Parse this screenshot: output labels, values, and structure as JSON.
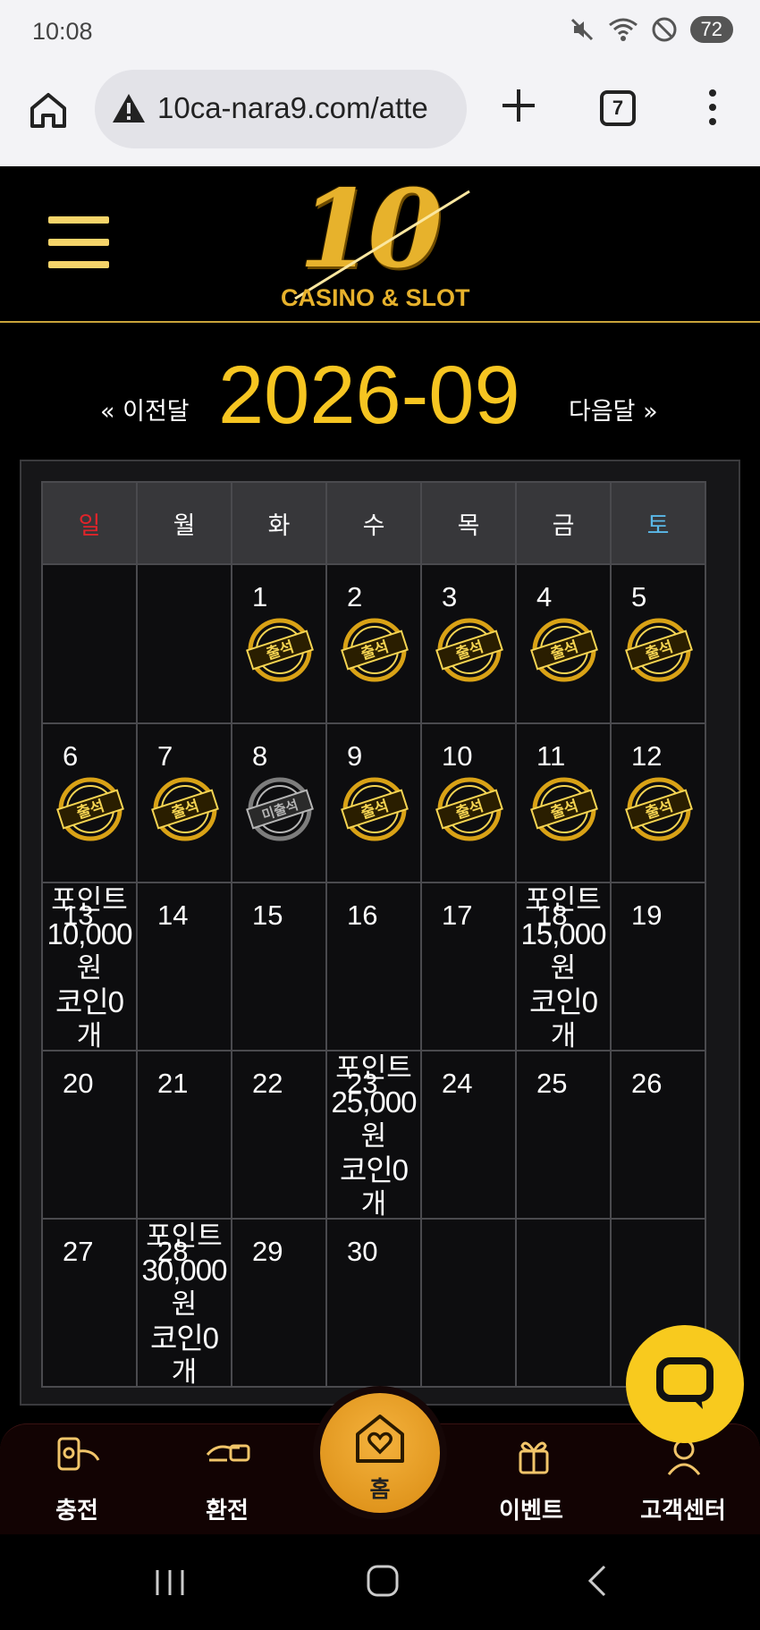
{
  "status_bar": {
    "time": "10:08",
    "battery": "72"
  },
  "browser": {
    "url": "10ca-nara9.com/atte",
    "tab_count": "7"
  },
  "logo": {
    "number": "10",
    "subtitle": "CASINO & SLOT"
  },
  "calendar": {
    "prev_label": "« 이전달",
    "month": "2026-09",
    "next_label": "다음달 »",
    "weekdays": [
      "일",
      "월",
      "화",
      "수",
      "목",
      "금",
      "토"
    ],
    "stamp_attended": "출석",
    "stamp_absent": "미출석",
    "weeks": [
      [
        {
          "day": "",
          "stamp": ""
        },
        {
          "day": "",
          "stamp": ""
        },
        {
          "day": "1",
          "stamp": "attended"
        },
        {
          "day": "2",
          "stamp": "attended"
        },
        {
          "day": "3",
          "stamp": "attended"
        },
        {
          "day": "4",
          "stamp": "attended"
        },
        {
          "day": "5",
          "stamp": "attended"
        }
      ],
      [
        {
          "day": "6",
          "stamp": "attended"
        },
        {
          "day": "7",
          "stamp": "attended"
        },
        {
          "day": "8",
          "stamp": "absent"
        },
        {
          "day": "9",
          "stamp": "attended"
        },
        {
          "day": "10",
          "stamp": "attended"
        },
        {
          "day": "11",
          "stamp": "attended"
        },
        {
          "day": "12",
          "stamp": "attended"
        }
      ],
      [
        {
          "day": "13",
          "reward": {
            "line1": "포인트",
            "amount": "10,000",
            "unit": "원",
            "coin": "코인0",
            "coin_unit": "개"
          }
        },
        {
          "day": "14"
        },
        {
          "day": "15"
        },
        {
          "day": "16"
        },
        {
          "day": "17"
        },
        {
          "day": "18",
          "reward": {
            "line1": "포인트",
            "amount": "15,000",
            "unit": "원",
            "coin": "코인0",
            "coin_unit": "개"
          }
        },
        {
          "day": "19"
        }
      ],
      [
        {
          "day": "20"
        },
        {
          "day": "21"
        },
        {
          "day": "22"
        },
        {
          "day": "23",
          "reward": {
            "line1": "포인트",
            "amount": "25,000",
            "unit": "원",
            "coin": "코인0",
            "coin_unit": "개"
          }
        },
        {
          "day": "24"
        },
        {
          "day": "25"
        },
        {
          "day": "26"
        }
      ],
      [
        {
          "day": "27"
        },
        {
          "day": "28",
          "reward": {
            "line1": "포인트",
            "amount": "30,000",
            "unit": "원",
            "coin": "코인0",
            "coin_unit": "개"
          }
        },
        {
          "day": "29"
        },
        {
          "day": "30"
        },
        {
          "day": ""
        },
        {
          "day": ""
        },
        {
          "day": ""
        }
      ]
    ]
  },
  "bottom_nav": {
    "items": [
      {
        "label": "충전",
        "icon": "charge-icon"
      },
      {
        "label": "환전",
        "icon": "exchange-icon"
      },
      {
        "label": "홈",
        "icon": "home-heart-icon"
      },
      {
        "label": "이벤트",
        "icon": "gift-icon"
      },
      {
        "label": "고객센터",
        "icon": "support-icon"
      }
    ]
  },
  "colors": {
    "accent_gold": "#f6c521",
    "sunday_red": "#e0242a",
    "saturday_blue": "#5ab8e8",
    "home_orange": "#e99b22",
    "chat_yellow": "#f8ca1e"
  }
}
